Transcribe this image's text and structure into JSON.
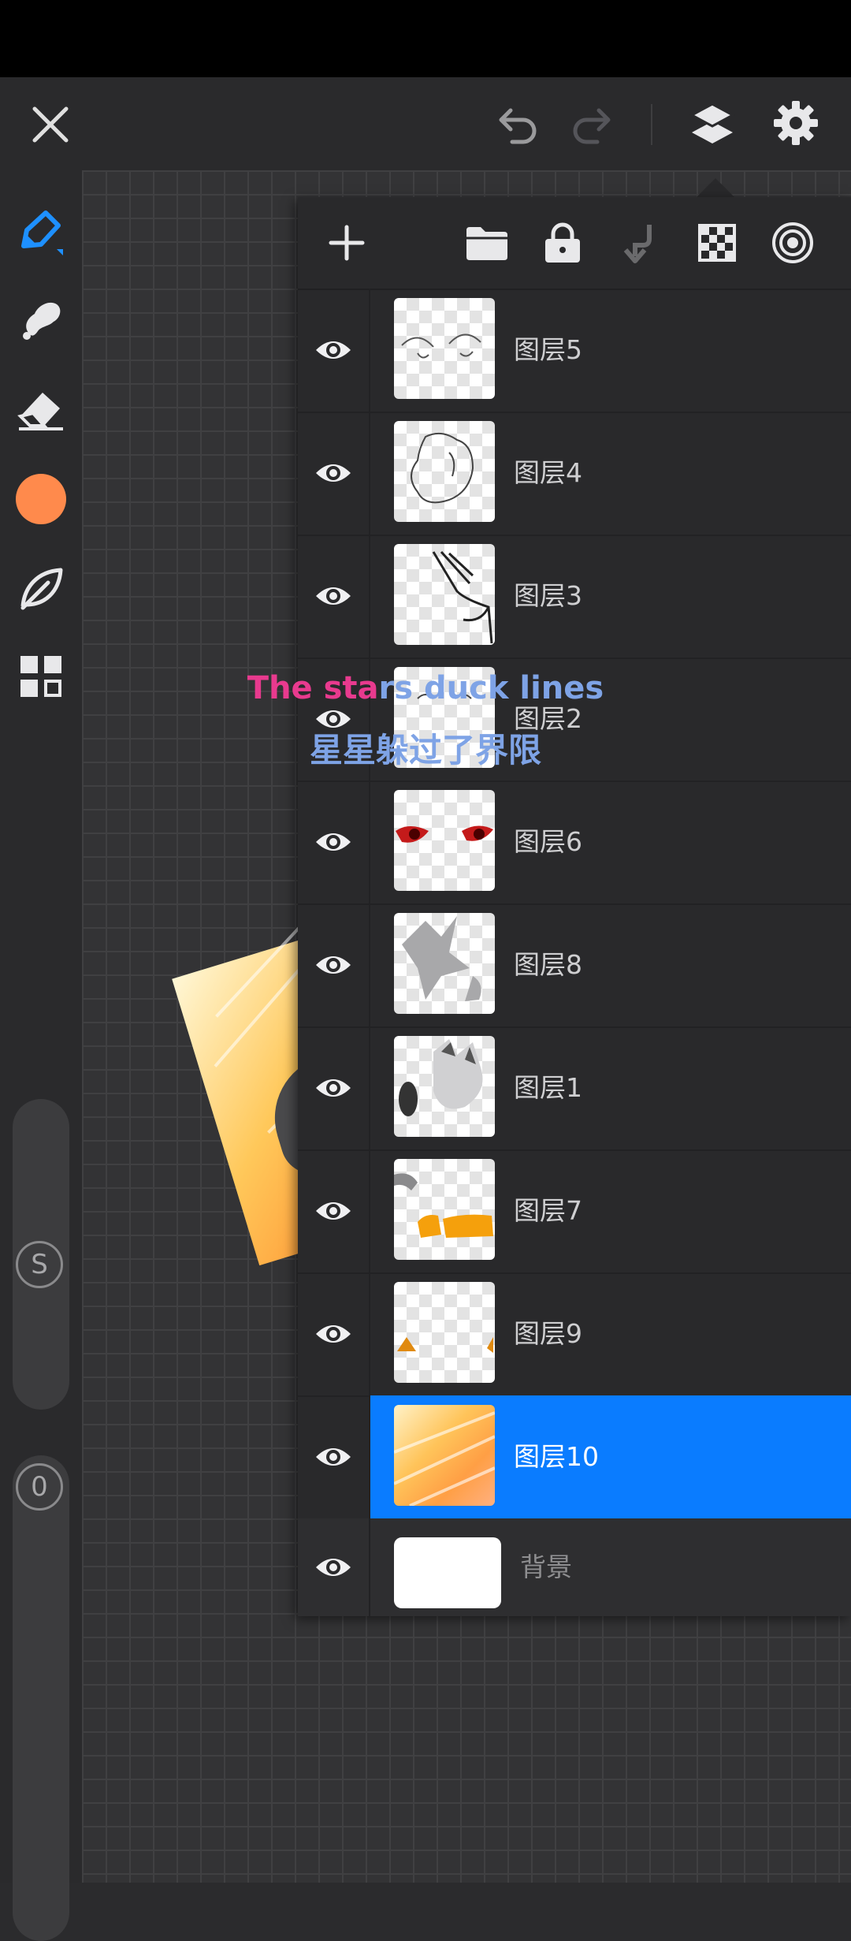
{
  "app": {
    "name": "painting-app",
    "accent": "#0a7cff",
    "brush_color": "#ff8a4c"
  },
  "top_bar": {
    "icons": [
      "close-icon",
      "undo-icon",
      "redo-icon",
      "layers-icon",
      "settings-icon"
    ]
  },
  "left_toolbar": {
    "tools": [
      "pencil-icon",
      "smudge-icon",
      "eraser-icon",
      "color-swatch",
      "leaf-icon",
      "grid-icon"
    ],
    "size_label": "S",
    "opacity_label": "0"
  },
  "layers_panel": {
    "toolbar_icons": [
      "add-icon",
      "folder-icon",
      "lock-icon",
      "merge-down-icon",
      "checker-icon",
      "target-icon"
    ],
    "layers": [
      {
        "name": "图层5",
        "selected": false
      },
      {
        "name": "图层4",
        "selected": false
      },
      {
        "name": "图层3",
        "selected": false
      },
      {
        "name": "图层2",
        "selected": false
      },
      {
        "name": "图层6",
        "selected": false
      },
      {
        "name": "图层8",
        "selected": false
      },
      {
        "name": "图层1",
        "selected": false
      },
      {
        "name": "图层7",
        "selected": false
      },
      {
        "name": "图层9",
        "selected": false
      },
      {
        "name": "图层10",
        "selected": true
      }
    ],
    "background_layer": "背景"
  },
  "subtitle": {
    "en_part1": "The sta",
    "en_part2": "rs duck lines",
    "zh": "星星躲过了界限"
  }
}
